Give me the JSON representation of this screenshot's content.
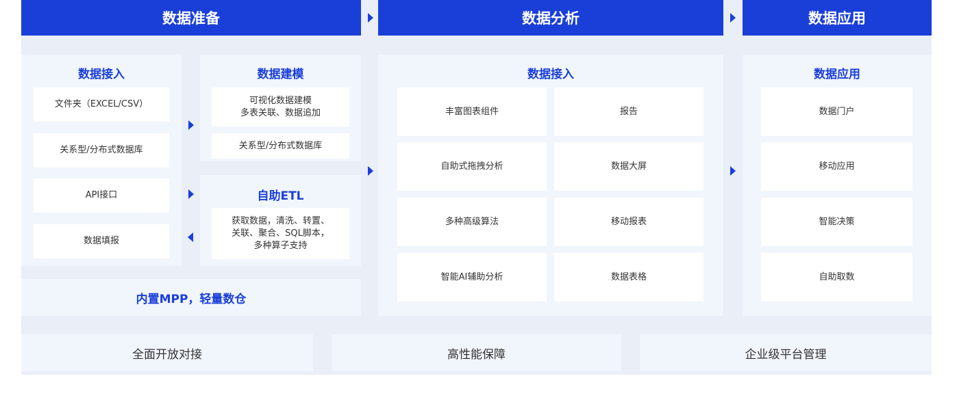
{
  "headers": {
    "prep": "数据准备",
    "analysis": "数据分析",
    "application": "数据应用"
  },
  "prep": {
    "access_title": "数据接入",
    "access_items": [
      "文件夹（EXCEL/CSV）",
      "关系型/分布式数据库",
      "API接口",
      "数据填报"
    ],
    "modeling_title": "数据建模",
    "modeling_items": [
      "可视化数据建模\n多表关联、数据追加",
      "关系型/分布式数据库"
    ],
    "etl_title": "自助ETL",
    "etl_desc": "获取数据，清洗、转置、\n关联、聚合、SQL脚本，\n多种算子支持",
    "mpp": "内置MPP，轻量数仓"
  },
  "analysis": {
    "title": "数据接入",
    "items": [
      "丰富图表组件",
      "报告",
      "自助式拖拽分析",
      "数据大屏",
      "多种高级算法",
      "移动报表",
      "智能AI辅助分析",
      "数据表格"
    ]
  },
  "application": {
    "title": "数据应用",
    "items": [
      "数据门户",
      "移动应用",
      "智能决策",
      "自助取数"
    ]
  },
  "footer": [
    "全面开放对接",
    "高性能保障",
    "企业级平台管理"
  ],
  "colors": {
    "accent": "#1a3fd9",
    "panel": "#f1f5fc",
    "stage": "#e9eef7"
  }
}
